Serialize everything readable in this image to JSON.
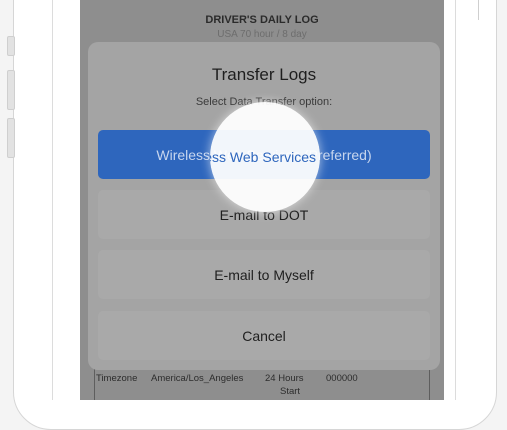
{
  "header": {
    "title": "DRIVER'S DAILY LOG",
    "subtitle": "USA 70 hour / 8 day"
  },
  "dialog": {
    "title": "Transfer Logs",
    "subtitle": "Select Data Transfer option:",
    "options": [
      {
        "label": "Wireless Web Services (Preferred)",
        "highlighted": true
      },
      {
        "label": "E-mail to DOT"
      },
      {
        "label": "E-mail to Myself"
      },
      {
        "label": "Cancel"
      }
    ]
  },
  "info_row": {
    "timezone_label": "Timezone",
    "timezone_value": "America/Los_Angeles",
    "hours_label": "24 Hours",
    "start_label": "Start",
    "number": "000000"
  },
  "colors": {
    "primary_button": "#2e66bd",
    "overlay": "#8e8e8e",
    "dialog": "#a4a4a4"
  }
}
